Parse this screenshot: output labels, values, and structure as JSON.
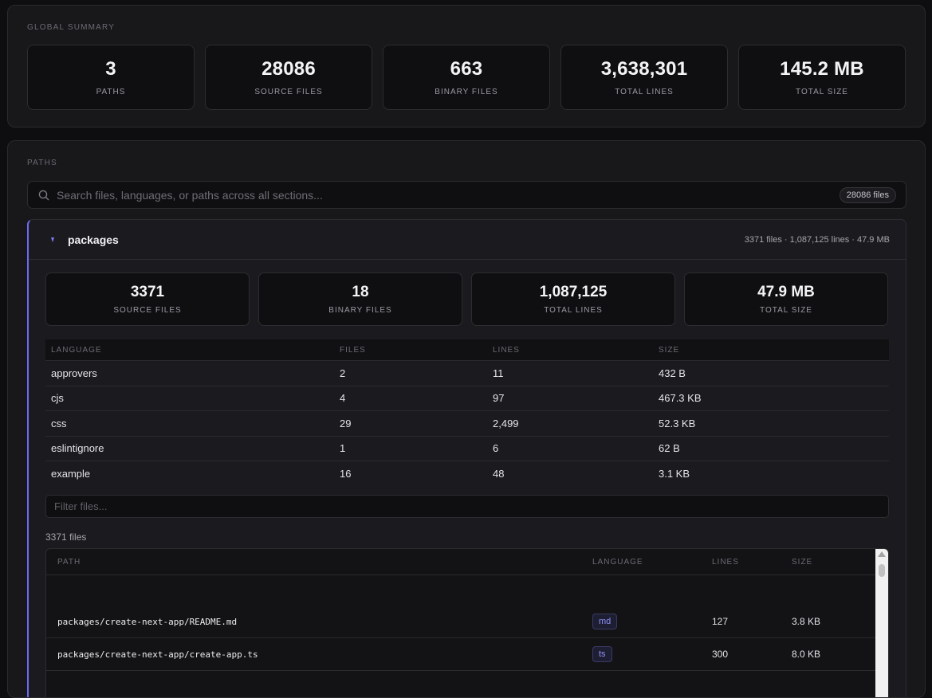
{
  "summary": {
    "title": "GLOBAL SUMMARY",
    "stats": [
      {
        "value": "3",
        "label": "PATHS"
      },
      {
        "value": "28086",
        "label": "SOURCE FILES"
      },
      {
        "value": "663",
        "label": "BINARY FILES"
      },
      {
        "value": "3,638,301",
        "label": "TOTAL LINES"
      },
      {
        "value": "145.2 MB",
        "label": "TOTAL SIZE"
      }
    ]
  },
  "paths": {
    "title": "PATHS",
    "search": {
      "placeholder": "Search files, languages, or paths across all sections...",
      "count_badge": "28086 files"
    },
    "groups": [
      {
        "name": "packages",
        "meta": "3371 files · 1,087,125 lines · 47.9 MB",
        "accent": "#6c6cf0",
        "stats": [
          {
            "value": "3371",
            "label": "SOURCE FILES"
          },
          {
            "value": "18",
            "label": "BINARY FILES"
          },
          {
            "value": "1,087,125",
            "label": "TOTAL LINES"
          },
          {
            "value": "47.9 MB",
            "label": "TOTAL SIZE"
          }
        ],
        "languages": {
          "headers": [
            "LANGUAGE",
            "FILES",
            "LINES",
            "SIZE"
          ],
          "rows": [
            {
              "language": "approvers",
              "files": "2",
              "lines": "11",
              "size": "432 B"
            },
            {
              "language": "cjs",
              "files": "4",
              "lines": "97",
              "size": "467.3 KB"
            },
            {
              "language": "css",
              "files": "29",
              "lines": "2,499",
              "size": "52.3 KB"
            },
            {
              "language": "eslintignore",
              "files": "1",
              "lines": "6",
              "size": "62 B"
            },
            {
              "language": "example",
              "files": "16",
              "lines": "48",
              "size": "3.1 KB"
            }
          ]
        },
        "filter_placeholder": "Filter files...",
        "file_count": "3371 files",
        "files": {
          "headers": [
            "PATH",
            "LANGUAGE",
            "LINES",
            "SIZE"
          ],
          "rows": [
            {
              "path": "packages/create-next-app/README.md",
              "language": "md",
              "lines": "127",
              "size": "3.8 KB"
            },
            {
              "path": "packages/create-next-app/create-app.ts",
              "language": "ts",
              "lines": "300",
              "size": "8.0 KB"
            }
          ]
        }
      }
    ]
  }
}
